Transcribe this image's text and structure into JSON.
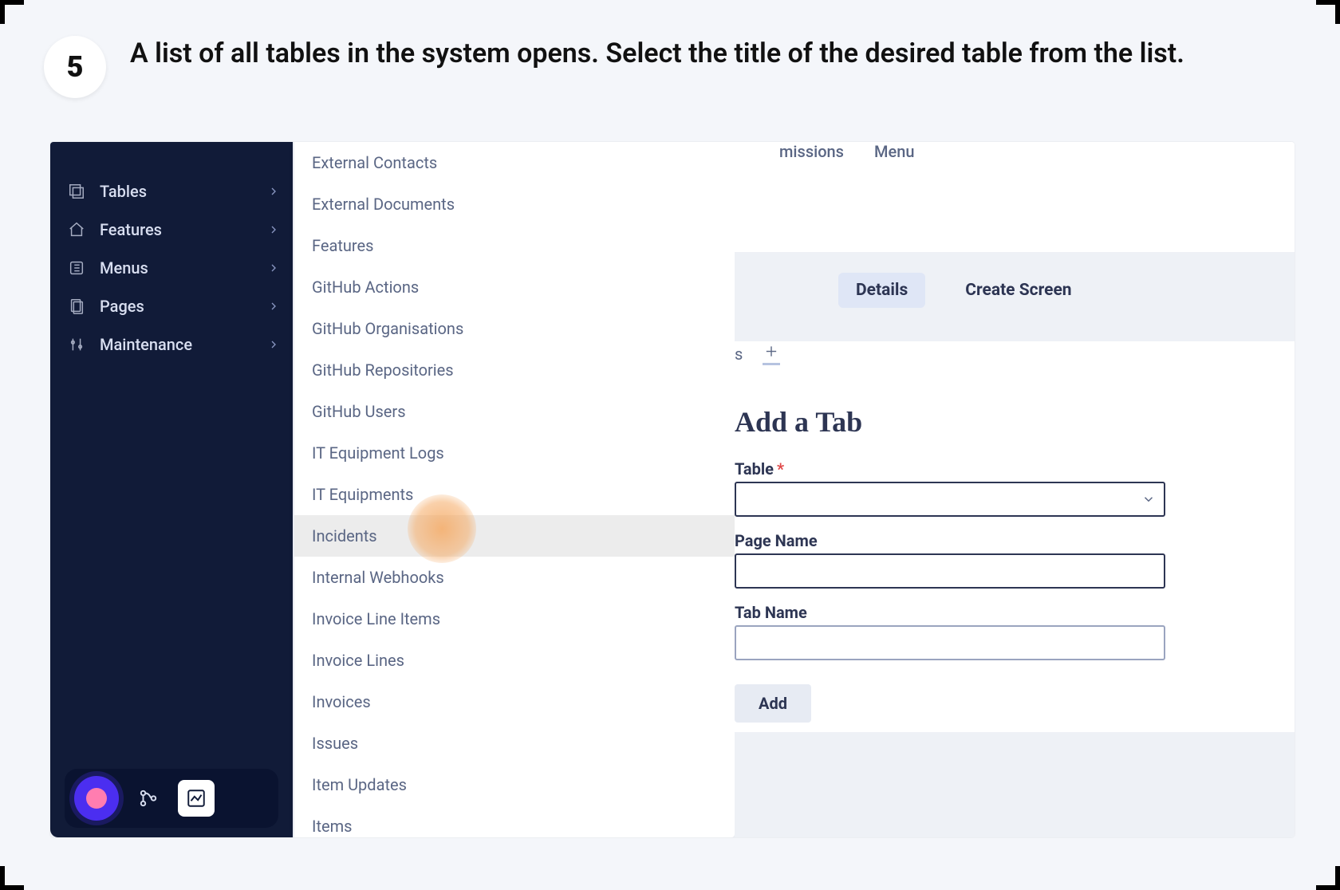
{
  "step": {
    "number": "5",
    "text": "A list of all tables in the system opens. Select the title of the desired table from the list."
  },
  "sidebar": {
    "items": [
      {
        "label": "Tables"
      },
      {
        "label": "Features"
      },
      {
        "label": "Menus"
      },
      {
        "label": "Pages"
      },
      {
        "label": "Maintenance"
      }
    ]
  },
  "dropdown": {
    "items": [
      "External Contacts",
      "External Documents",
      "Features",
      "GitHub Actions",
      "GitHub Organisations",
      "GitHub Repositories",
      "GitHub Users",
      "IT Equipment Logs",
      "IT Equipments",
      "Incidents",
      "Internal Webhooks",
      "Invoice Line Items",
      "Invoice Lines",
      "Invoices",
      "Issues",
      "Item Updates",
      "Items"
    ],
    "highlighted_index": 9
  },
  "top_tabs": {
    "partial": "missions",
    "items": [
      "Menu"
    ]
  },
  "sub_tabs": {
    "items": [
      "Details",
      "Create Screen"
    ],
    "active_index": 0
  },
  "mini_row": {
    "partial": "s"
  },
  "form": {
    "title": "Add a Tab",
    "fields": {
      "table": {
        "label": "Table",
        "required": true,
        "value": ""
      },
      "page_name": {
        "label": "Page Name",
        "value": ""
      },
      "tab_name": {
        "label": "Tab Name",
        "value": ""
      }
    },
    "submit": "Add"
  }
}
